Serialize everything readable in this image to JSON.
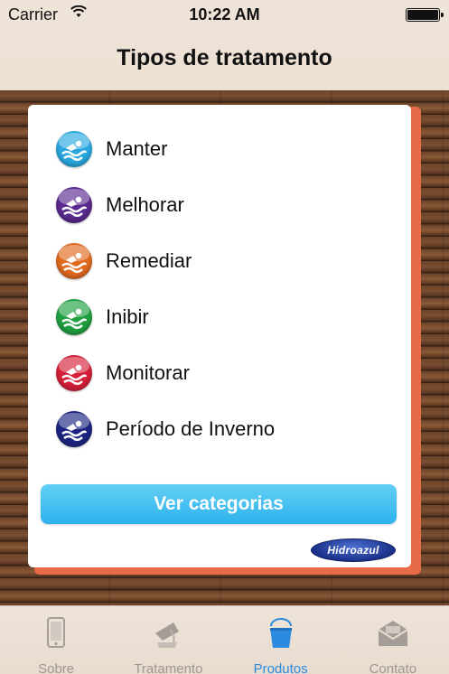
{
  "status_bar": {
    "carrier": "Carrier",
    "time": "10:22 AM"
  },
  "nav": {
    "title": "Tipos de tratamento"
  },
  "treatments": [
    {
      "label": "Manter",
      "color": "#29a8e0"
    },
    {
      "label": "Melhorar",
      "color": "#5a2a8f"
    },
    {
      "label": "Remediar",
      "color": "#e06a1e"
    },
    {
      "label": "Inibir",
      "color": "#20a040"
    },
    {
      "label": "Monitorar",
      "color": "#d61f3a"
    },
    {
      "label": "Período de Inverno",
      "color": "#1c2580"
    }
  ],
  "button": {
    "label": "Ver categorias"
  },
  "logo": {
    "text": "Hidroazul"
  },
  "tabs": [
    {
      "label": "Sobre",
      "icon": "phone-icon",
      "active": false
    },
    {
      "label": "Tratamento",
      "icon": "pour-icon",
      "active": false
    },
    {
      "label": "Produtos",
      "icon": "bucket-icon",
      "active": true
    },
    {
      "label": "Contato",
      "icon": "envelope-icon",
      "active": false
    }
  ]
}
